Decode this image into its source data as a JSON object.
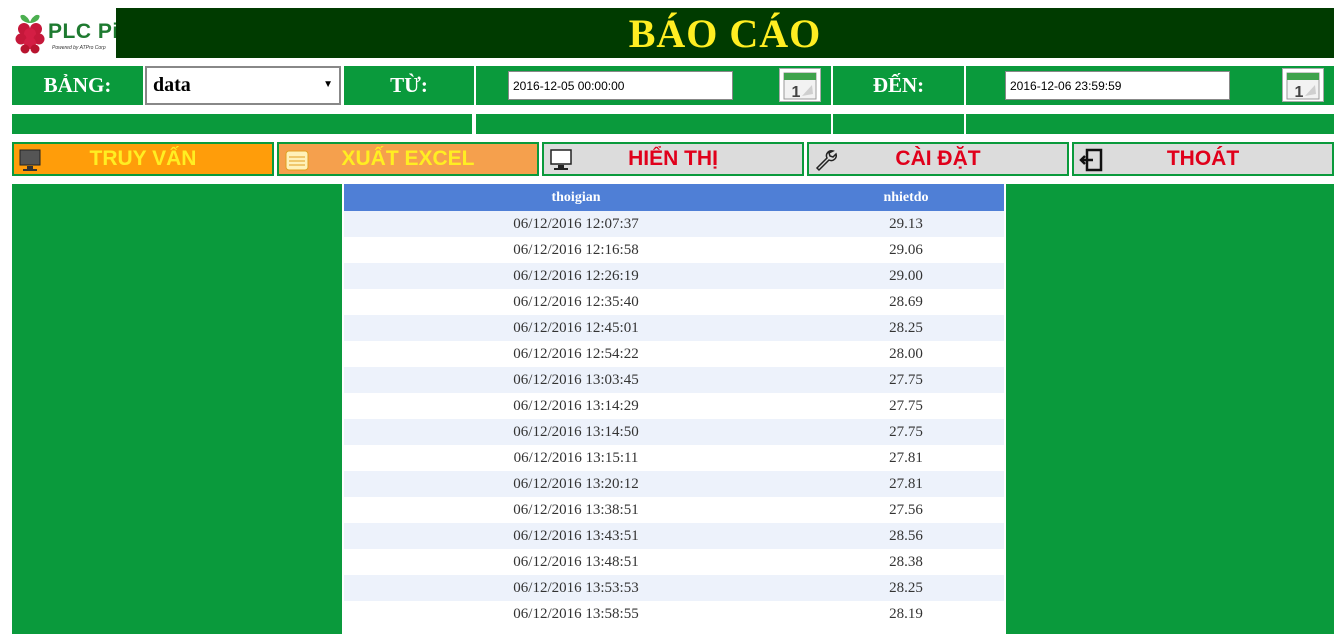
{
  "app": {
    "logo_text": "PLC Pi",
    "logo_tagline": "Powered by ATPro Corp",
    "title": "BÁO CÁO"
  },
  "filter": {
    "table_label": "BẢNG:",
    "table_value": "data",
    "from_label": "TỪ:",
    "from_value": "2016-12-05 00:00:00",
    "to_label": "ĐẾN:",
    "to_value": "2016-12-06 23:59:59",
    "calendar_icon_text": "1"
  },
  "actions": {
    "query": "TRUY VẤN",
    "export_excel": "XUẤT EXCEL",
    "display": "HIỂN THỊ",
    "settings": "CÀI ĐẶT",
    "exit": "THOÁT"
  },
  "table": {
    "columns": [
      "thoigian",
      "nhietdo"
    ],
    "rows": [
      [
        "06/12/2016 12:07:37",
        "29.13"
      ],
      [
        "06/12/2016 12:16:58",
        "29.06"
      ],
      [
        "06/12/2016 12:26:19",
        "29.00"
      ],
      [
        "06/12/2016 12:35:40",
        "28.69"
      ],
      [
        "06/12/2016 12:45:01",
        "28.25"
      ],
      [
        "06/12/2016 12:54:22",
        "28.00"
      ],
      [
        "06/12/2016 13:03:45",
        "27.75"
      ],
      [
        "06/12/2016 13:14:29",
        "27.75"
      ],
      [
        "06/12/2016 13:14:50",
        "27.75"
      ],
      [
        "06/12/2016 13:15:11",
        "27.81"
      ],
      [
        "06/12/2016 13:20:12",
        "27.81"
      ],
      [
        "06/12/2016 13:38:51",
        "27.56"
      ],
      [
        "06/12/2016 13:43:51",
        "28.56"
      ],
      [
        "06/12/2016 13:48:51",
        "28.38"
      ],
      [
        "06/12/2016 13:53:53",
        "28.25"
      ],
      [
        "06/12/2016 13:58:55",
        "28.19"
      ]
    ]
  },
  "colors": {
    "green": "#0a9a3c",
    "dark_green": "#003b00",
    "title_yellow": "#ffee22",
    "header_blue": "#4f7fd6",
    "orange": "#ff9d0a",
    "red_text": "#e0001b"
  },
  "icons": {
    "logo": "raspberry-logo-icon",
    "calendar": "calendar-icon",
    "query": "monitor-icon",
    "export": "spreadsheet-icon",
    "display": "computer-icon",
    "settings": "wrench-icon",
    "exit": "exit-door-icon"
  }
}
